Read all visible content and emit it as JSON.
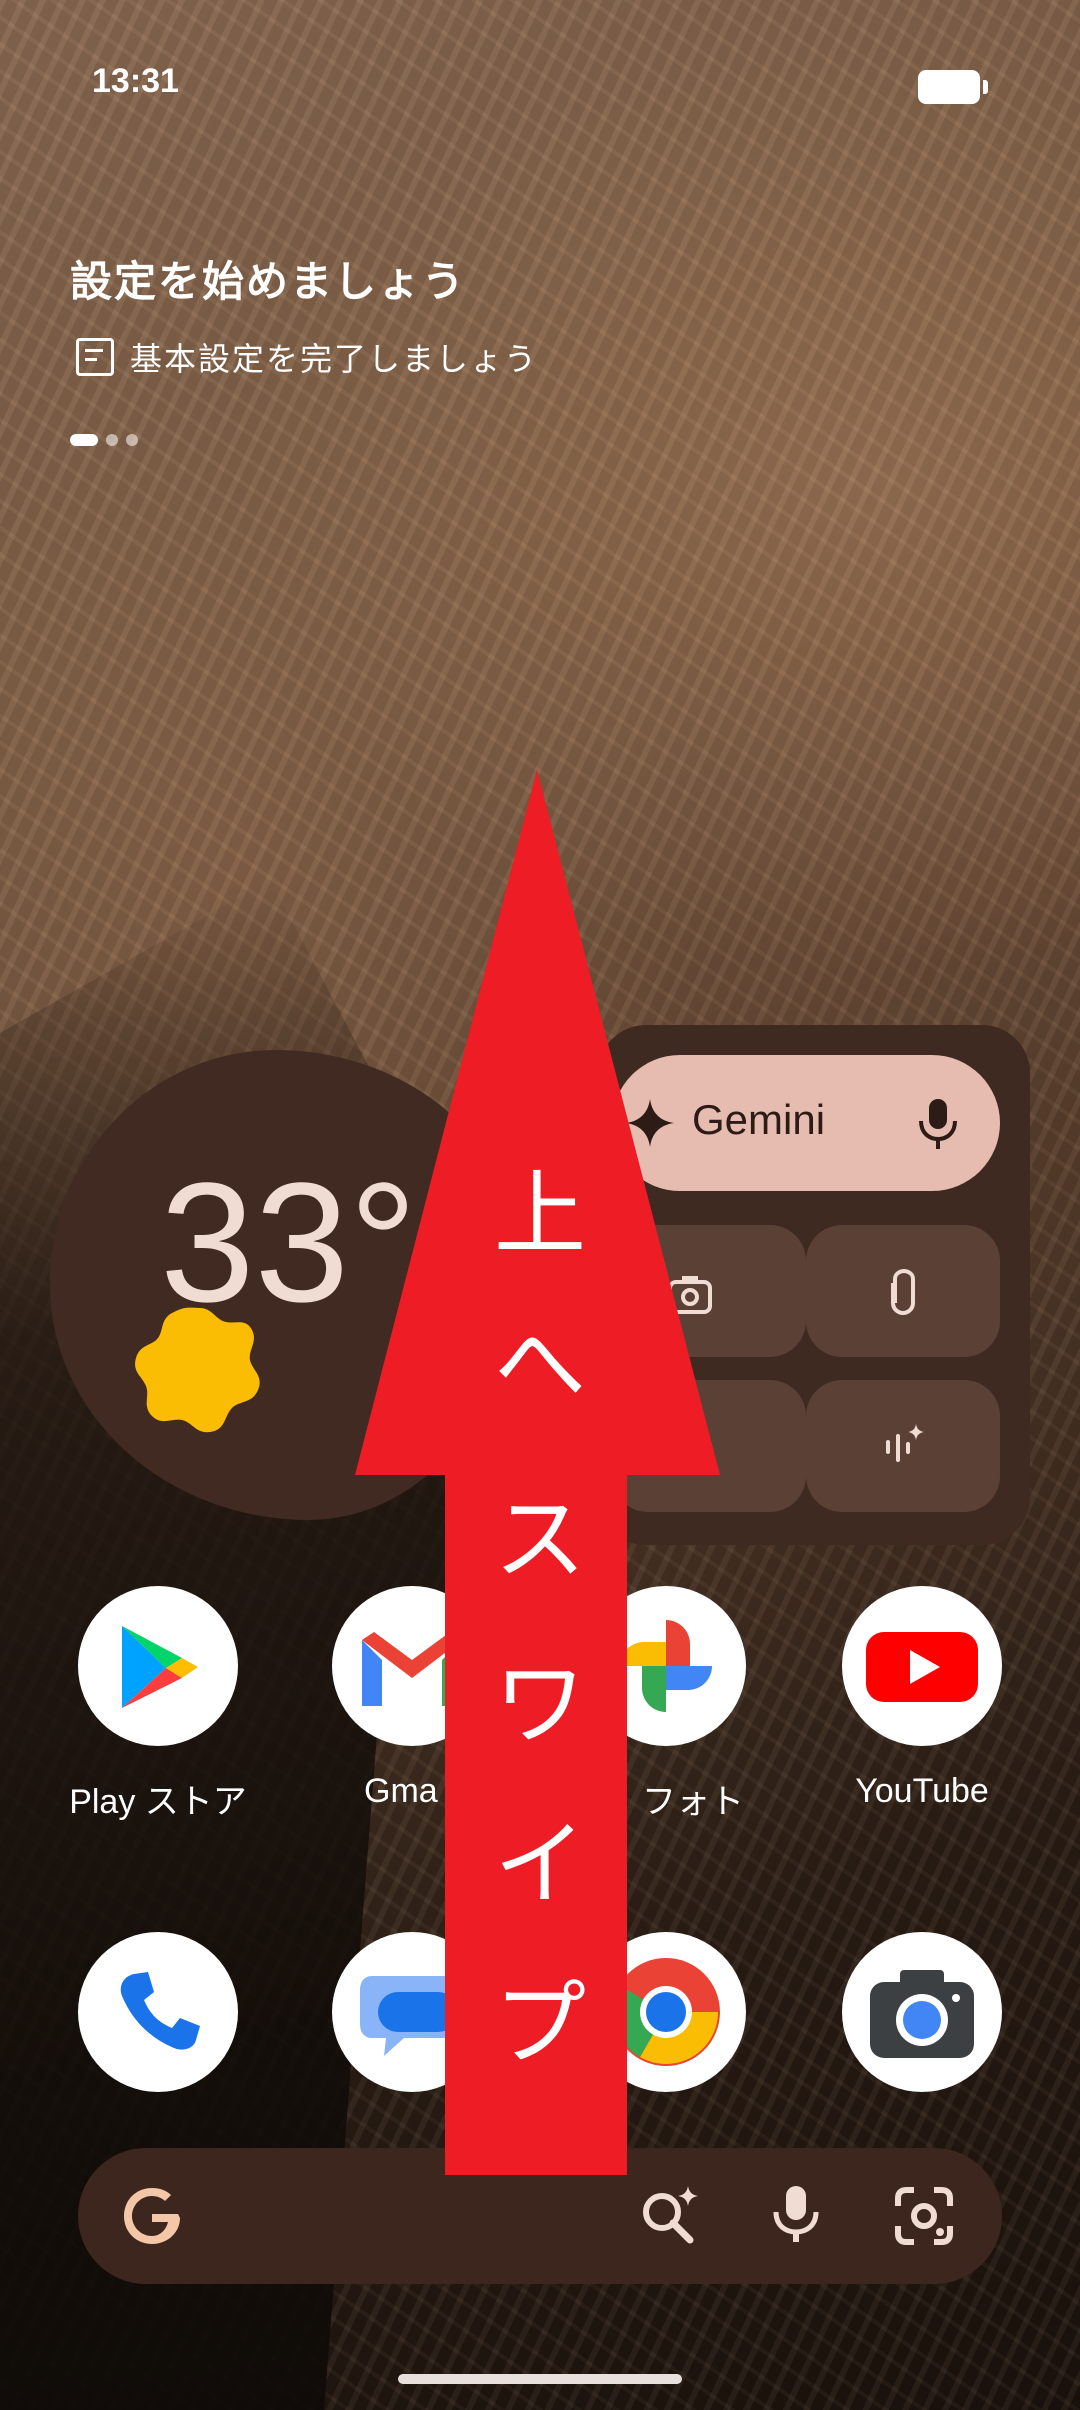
{
  "status_bar": {
    "time": "13:31"
  },
  "setup_widget": {
    "title": "設定を始めましょう",
    "subtitle": "基本設定を完了しましょう",
    "page_dots": 3,
    "active_dot": 0
  },
  "weather_widget": {
    "temperature": "33°"
  },
  "gemini_widget": {
    "label": "Gemini"
  },
  "apps_row1": [
    {
      "label": "Play ストア"
    },
    {
      "label": "Gma"
    },
    {
      "label": "フォト"
    },
    {
      "label": "YouTube"
    }
  ],
  "search_bar": {
    "logo": "G"
  },
  "overlay": {
    "characters": [
      "上",
      "へ",
      "ス",
      "ワ",
      "イ",
      "プ"
    ]
  },
  "colors": {
    "overlay_red": "#ee1c25",
    "widget_bg": "#3f2a22",
    "gemini_bar": "#e6bcb0",
    "sun": "#fbbc04"
  }
}
